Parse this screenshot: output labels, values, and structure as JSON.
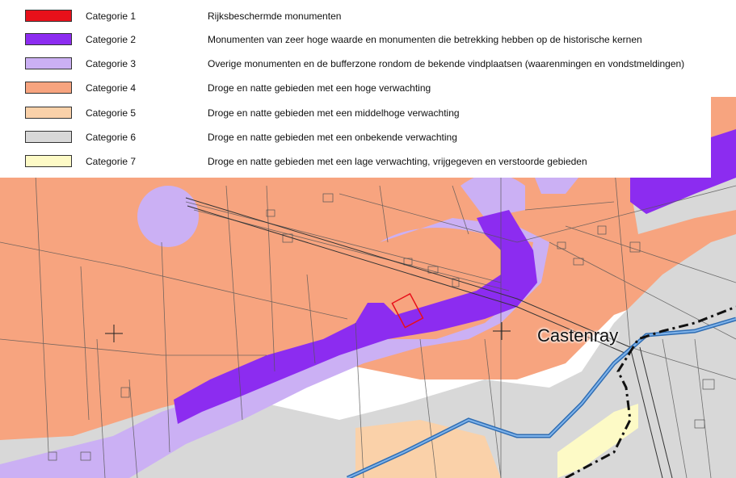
{
  "legend": {
    "items": [
      {
        "label": "Categorie 1",
        "description": "Rijksbeschermde monumenten",
        "color": "#e8101a"
      },
      {
        "label": "Categorie 2",
        "description": "Monumenten van zeer hoge waarde en monumenten die betrekking hebben op de historische kernen",
        "color": "#8c2cf0"
      },
      {
        "label": "Categorie 3",
        "description": "Overige monumenten en de bufferzone rondom de bekende vindplaatsen (waarenmingen en vondstmeldingen)",
        "color": "#cbb0f4"
      },
      {
        "label": "Categorie 4",
        "description": "Droge en natte gebieden met een hoge verwachting",
        "color": "#f7a47f"
      },
      {
        "label": "Categorie 5",
        "description": "Droge en natte gebieden met een middelhoge verwachting",
        "color": "#fad1a9"
      },
      {
        "label": "Categorie 6",
        "description": "Droge en natte gebieden met een onbekende verwachting",
        "color": "#d8d8d8"
      },
      {
        "label": "Categorie 7",
        "description": "Droge en natte gebieden met een lage verwachting, vrijgegeven en verstoorde gebieden",
        "color": "#fdfac6"
      }
    ]
  },
  "map": {
    "place_label": "Castenray",
    "colors": {
      "stream": "#4a8fd6",
      "boundary": "#111111",
      "parcel_lines": "#555555"
    }
  }
}
